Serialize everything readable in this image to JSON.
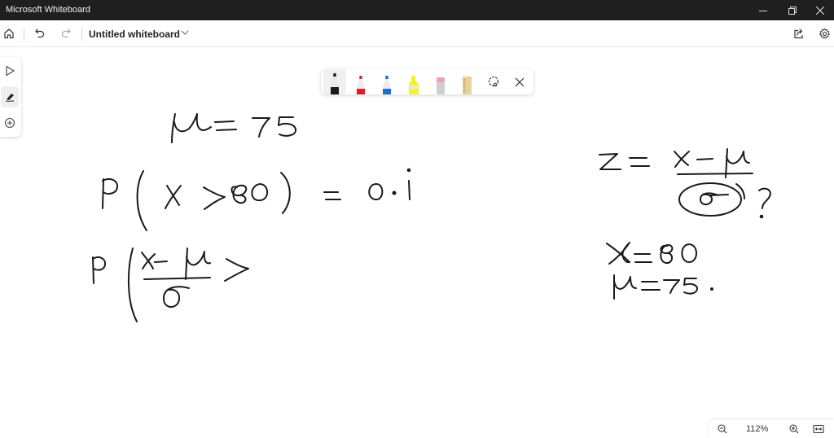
{
  "window": {
    "title": "Microsoft Whiteboard",
    "controls": [
      "minimize",
      "restore",
      "close"
    ]
  },
  "appbar": {
    "board_title": "Untitled whiteboard",
    "icons": [
      "home-icon",
      "undo-icon",
      "redo-icon",
      "chevron-down-icon",
      "share-icon",
      "settings-icon"
    ]
  },
  "left_rail": {
    "tools": [
      {
        "name": "select",
        "icon": "pointer-icon",
        "active": false
      },
      {
        "name": "inking",
        "icon": "pen-icon",
        "active": true
      },
      {
        "name": "create",
        "icon": "add-icon",
        "active": false
      }
    ]
  },
  "ink_toolbar": {
    "tools": [
      {
        "name": "black-pen",
        "color": "#1a1a1a",
        "active": true
      },
      {
        "name": "red-pen",
        "color": "#e01e2b",
        "active": false
      },
      {
        "name": "blue-pen",
        "color": "#1a6fd0",
        "active": false
      },
      {
        "name": "highlighter",
        "color": "#f4f12a",
        "active": false
      },
      {
        "name": "eraser",
        "color": "#f0a0b0",
        "active": false
      },
      {
        "name": "ruler",
        "color": "#e8d39a",
        "active": false
      },
      {
        "name": "lasso-select",
        "active": false
      },
      {
        "name": "close",
        "active": false
      }
    ]
  },
  "zoom": {
    "level": "112%",
    "icons": [
      "zoom-out-icon",
      "zoom-in-icon",
      "fit-to-screen-icon"
    ]
  },
  "canvas_ink": {
    "lines": [
      "μ = 75",
      "P ( X > 80 ) = 0·1",
      "P ( (X − μ)/σ >",
      "Z = (x − μ)/σ ?",
      "X = 80",
      "μ = 75"
    ]
  }
}
